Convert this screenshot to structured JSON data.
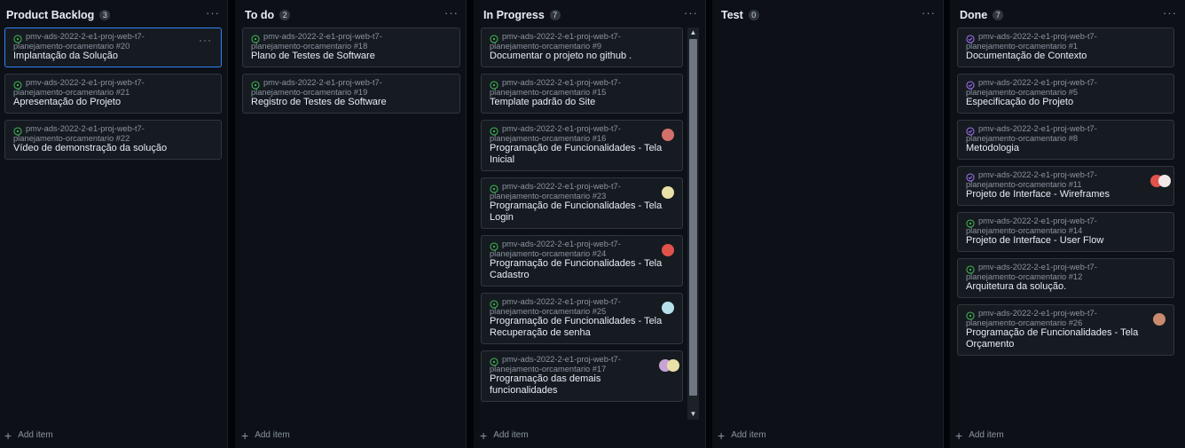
{
  "columns": [
    {
      "title": "Product Backlog",
      "count": "3",
      "add_label": "Add item",
      "cards": [
        {
          "repo": "pmv-ads-2022-2-e1-proj-web-t7-",
          "repo2": "planejamento-orcamentario #20",
          "title": "Implantação da Solução",
          "status": "open",
          "selected": true
        },
        {
          "repo": "pmv-ads-2022-2-e1-proj-web-t7-",
          "repo2": "planejamento-orcamentario #21",
          "title": "Apresentação do Projeto",
          "status": "open"
        },
        {
          "repo": "pmv-ads-2022-2-e1-proj-web-t7-",
          "repo2": "planejamento-orcamentario #22",
          "title": "Vídeo de demonstração da solução",
          "status": "open"
        }
      ]
    },
    {
      "title": "To do",
      "count": "2",
      "add_label": "Add item",
      "cards": [
        {
          "repo": "pmv-ads-2022-2-e1-proj-web-t7-",
          "repo2": "planejamento-orcamentario #18",
          "title": "Plano de Testes de Software",
          "status": "open"
        },
        {
          "repo": "pmv-ads-2022-2-e1-proj-web-t7-",
          "repo2": "planejamento-orcamentario #19",
          "title": "Registro de Testes de Software",
          "status": "open"
        }
      ]
    },
    {
      "title": "In Progress",
      "count": "7",
      "add_label": "Add item",
      "cards": [
        {
          "repo": "pmv-ads-2022-2-e1-proj-web-t7-",
          "repo2": "planejamento-orcamentario #9",
          "title": "Documentar o projeto no github .",
          "status": "open"
        },
        {
          "repo": "pmv-ads-2022-2-e1-proj-web-t7-",
          "repo2": "planejamento-orcamentario #15",
          "title": "Template padrão do Site",
          "status": "open"
        },
        {
          "repo": "pmv-ads-2022-2-e1-proj-web-t7-",
          "repo2": "planejamento-orcamentario #16",
          "title": "Programação de Funcionalidades - Tela Inicial",
          "status": "open",
          "avatar": "#d4706a"
        },
        {
          "repo": "pmv-ads-2022-2-e1-proj-web-t7-",
          "repo2": "planejamento-orcamentario #23",
          "title": "Programação de Funcionalidades - Tela Login",
          "status": "open",
          "avatar": "#e8e0a8"
        },
        {
          "repo": "pmv-ads-2022-2-e1-proj-web-t7-",
          "repo2": "planejamento-orcamentario #24",
          "title": "Programação de Funcionalidades - Tela Cadastro",
          "status": "open",
          "avatar": "#e0524a"
        },
        {
          "repo": "pmv-ads-2022-2-e1-proj-web-t7-",
          "repo2": "planejamento-orcamentario #25",
          "title": "Programação de Funcionalidades - Tela Recuperação de senha",
          "status": "open",
          "avatar": "#b8e0ea"
        },
        {
          "repo": "pmv-ads-2022-2-e1-proj-web-t7-",
          "repo2": "planejamento-orcamentario #17",
          "title": "Programação das demais funcionalidades",
          "status": "open",
          "avatar": "#c7a3d6",
          "avatar2": "#e8e0a8"
        }
      ]
    },
    {
      "title": "Test",
      "count": "0",
      "add_label": "Add item",
      "cards": []
    },
    {
      "title": "Done",
      "count": "7",
      "add_label": "Add item",
      "cards": [
        {
          "repo": "pmv-ads-2022-2-e1-proj-web-t7-",
          "repo2": "planejamento-orcamentario #1",
          "title": "Documentação de Contexto",
          "status": "closed"
        },
        {
          "repo": "pmv-ads-2022-2-e1-proj-web-t7-",
          "repo2": "planejamento-orcamentario #5",
          "title": "Especificação do Projeto",
          "status": "closed"
        },
        {
          "repo": "pmv-ads-2022-2-e1-proj-web-t7-",
          "repo2": "planejamento-orcamentario #8",
          "title": "Metodologia",
          "status": "closed"
        },
        {
          "repo": "pmv-ads-2022-2-e1-proj-web-t7-",
          "repo2": "planejamento-orcamentario #11",
          "title": "Projeto de Interface - Wireframes",
          "status": "closed",
          "avatar": "#e0524a",
          "avatar2": "#f0e8e8"
        },
        {
          "repo": "pmv-ads-2022-2-e1-proj-web-t7-",
          "repo2": "planejamento-orcamentario #14",
          "title": "Projeto de Interface - User Flow",
          "status": "open"
        },
        {
          "repo": "pmv-ads-2022-2-e1-proj-web-t7-",
          "repo2": "planejamento-orcamentario #12",
          "title": "Arquitetura da solução.",
          "status": "open"
        },
        {
          "repo": "pmv-ads-2022-2-e1-proj-web-t7-",
          "repo2": "planejamento-orcamentario #26",
          "title": "Programação de Funcionalidades - Tela Orçamento",
          "status": "open",
          "avatar": "#c98a6e"
        }
      ]
    }
  ],
  "colors": {
    "open": "#3fb950",
    "closed": "#a371f7",
    "selected": "#2f81f7"
  }
}
